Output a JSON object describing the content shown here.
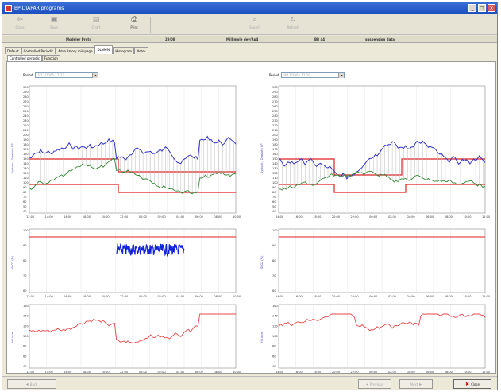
{
  "window": {
    "title": "BP-DIAPAR programs"
  },
  "toolbar": {
    "buttons": [
      {
        "name": "close-button",
        "label": "Close",
        "icon": "door-icon"
      },
      {
        "name": "save-button",
        "label": "Save",
        "icon": "disk-icon"
      },
      {
        "name": "chart-button",
        "label": "Chart",
        "icon": "chart-icon"
      },
      {
        "name": "print-button",
        "label": "Print",
        "icon": "printer-icon"
      },
      {
        "name": "search-button",
        "label": "Search",
        "icon": "magnifier-icon"
      },
      {
        "name": "refresh-button",
        "label": "Refresh",
        "icon": "refresh-icon"
      }
    ]
  },
  "infobar": {
    "name": "Modeler Proto",
    "id": "29/08",
    "desc": "Millimole dev/Rp4",
    "code": "BB 44",
    "extra": "suspension data"
  },
  "tabs": [
    "Default",
    "Controlled Periodic",
    "Ambulatory minipage",
    "DLNM90",
    "Histogram",
    "Notes"
  ],
  "subtabs": [
    "Controlled periodic",
    "Function"
  ],
  "left": {
    "period_label": "Period",
    "period_value": "5/12/2005 17:23"
  },
  "right": {
    "period_label": "Period",
    "period_value": "9/11/2005 17:20"
  },
  "axis": {
    "bp_label": "Systolic / Diastolic BP",
    "spo2_label": "SPO2 (%)",
    "hr_label": "HR bpm"
  },
  "left_times": [
    "12:00",
    "14:00",
    "16:00",
    "18:00",
    "20:00",
    "22:00",
    "00:00",
    "02:00",
    "04:00",
    "06:00",
    "08:00",
    "10:00"
  ],
  "right_times": [
    "14:00",
    "16:00",
    "18:00",
    "20:00",
    "22:00",
    "00:00",
    "02:00",
    "04:00",
    "06:00",
    "08:00",
    "10:00",
    "12:00"
  ],
  "bp_ticks": [
    "300",
    "290",
    "280",
    "270",
    "260",
    "250",
    "240",
    "230",
    "220",
    "210",
    "200",
    "190",
    "180",
    "170",
    "160",
    "150",
    "140",
    "130",
    "120",
    "110",
    "100",
    "90",
    "80",
    "70",
    "60",
    "50",
    "40"
  ],
  "spo2_ticks": [
    "100",
    "90",
    "80",
    "70",
    "60"
  ],
  "hr_ticks": [
    "160",
    "140",
    "120",
    "100",
    "80",
    "60",
    "40"
  ],
  "statusbar": {
    "back": "Back",
    "prev": "Previous",
    "next": "Next",
    "close": "Close"
  },
  "colors": {
    "systolic": "#3333cc",
    "diastolic": "#338833",
    "threshold": "#dd2222",
    "spo2": "#1122dd",
    "hr": "#ee4444"
  }
}
